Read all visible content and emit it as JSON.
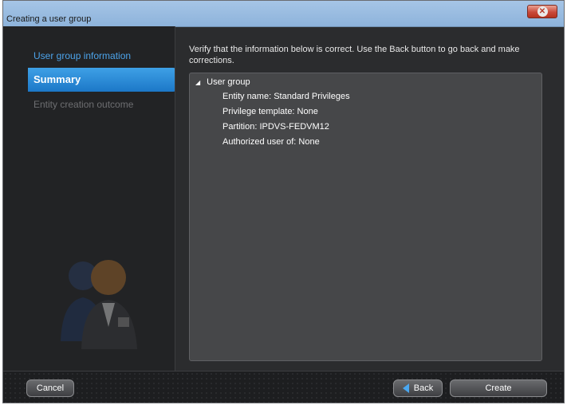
{
  "window": {
    "title": "Creating a user group",
    "close_glyph": "✕"
  },
  "sidebar": {
    "items": [
      {
        "label": "User group information",
        "state": "completed"
      },
      {
        "label": "Summary",
        "state": "active"
      },
      {
        "label": "Entity creation outcome",
        "state": "disabled"
      }
    ],
    "illustration": "users-icon"
  },
  "main": {
    "instructions": "Verify that the information below is correct. Use the Back button to go back and make corrections.",
    "tree": {
      "root_label": "User group",
      "expand_glyph": "◢",
      "children": [
        "Entity name: Standard Privileges",
        "Privilege template: None",
        "Partition: IPDVS-FEDVM12",
        "Authorized user of: None"
      ]
    }
  },
  "footer": {
    "cancel_label": "Cancel",
    "back_label": "Back",
    "create_label": "Create"
  },
  "colors": {
    "accent": "#1c78c7",
    "link": "#4ca3ea",
    "background": "#2b2c2e",
    "panel": "#464749"
  }
}
